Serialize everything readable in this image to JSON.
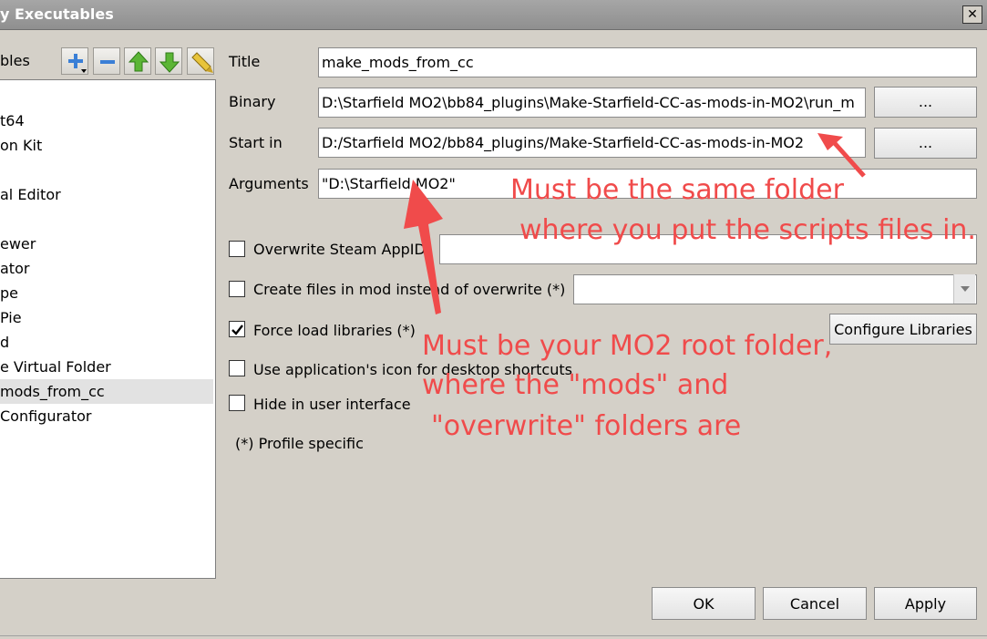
{
  "window": {
    "title": "y Executables",
    "close_glyph": "✕"
  },
  "sidebar": {
    "label": "bles",
    "toolbar_icons": [
      "add-icon",
      "remove-icon",
      "move-up-icon",
      "move-down-icon",
      "clear-icon"
    ],
    "items": [
      {
        "label": "t64"
      },
      {
        "label": "on Kit"
      },
      {
        "label": "al Editor"
      },
      {
        "label": "ewer"
      },
      {
        "label": "ator"
      },
      {
        "label": "pe"
      },
      {
        "label": " Pie"
      },
      {
        "label": "d"
      },
      {
        "label": "e Virtual Folder"
      },
      {
        "label": "mods_from_cc",
        "selected": true
      },
      {
        "label": "Configurator"
      }
    ]
  },
  "form": {
    "title_label": "Title",
    "title_value": "make_mods_from_cc",
    "binary_label": "Binary",
    "binary_value": "D:\\Starfield MO2\\bb84_plugins\\Make-Starfield-CC-as-mods-in-MO2\\run_m",
    "binary_browse": "...",
    "startin_label": "Start in",
    "startin_value": "D:/Starfield MO2/bb84_plugins/Make-Starfield-CC-as-mods-in-MO2",
    "startin_browse": "...",
    "arguments_label": "Arguments",
    "arguments_value": "\"D:\\Starfield MO2\"",
    "overwrite_appid_label": "Overwrite Steam AppID",
    "overwrite_appid_value": "",
    "create_files_label": "Create files in mod instead of overwrite (*)",
    "force_load_label": "Force load libraries (*)",
    "configure_libraries_label": "Configure Libraries",
    "use_icon_label": "Use application's icon for desktop shortcuts",
    "hide_ui_label": "Hide in user interface",
    "profile_specific_note": "(*) Profile specific",
    "checkbox_states": {
      "overwrite_appid": false,
      "create_files": false,
      "force_load": true,
      "use_icon": false,
      "hide_ui": false
    }
  },
  "buttons": {
    "ok": "OK",
    "cancel": "Cancel",
    "apply": "Apply"
  },
  "annotations": {
    "startin_note_line1": "Must be the same folder",
    "startin_note_line2": "where you put the scripts files in.",
    "args_note_line1": "Must be your MO2 root folder,",
    "args_note_line2": "where the \"mods\" and",
    "args_note_line3": "\"overwrite\" folders are",
    "color": "#f04b4b"
  }
}
